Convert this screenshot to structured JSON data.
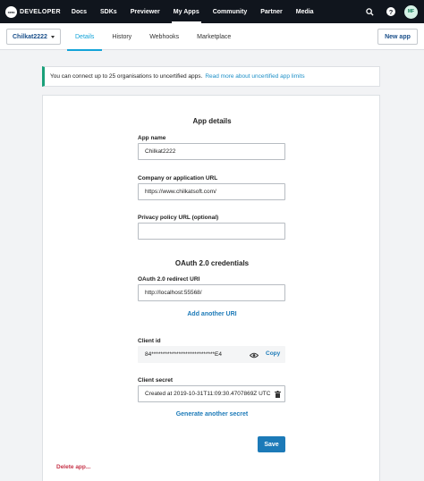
{
  "topnav": {
    "logo_mark": "xero",
    "logo_text": "DEVELOPER",
    "items": [
      {
        "label": "Docs"
      },
      {
        "label": "SDKs"
      },
      {
        "label": "Previewer"
      },
      {
        "label": "My Apps",
        "active": true
      },
      {
        "label": "Community"
      },
      {
        "label": "Partner"
      },
      {
        "label": "Media"
      }
    ],
    "icons": [
      "search-icon",
      "help-icon"
    ],
    "avatar_initials": "MF"
  },
  "subbar": {
    "app_selector": "Chilkat2222",
    "tabs": [
      {
        "label": "Details",
        "active": true
      },
      {
        "label": "History"
      },
      {
        "label": "Webhooks"
      },
      {
        "label": "Marketplace"
      }
    ],
    "new_app_label": "New app"
  },
  "notice": {
    "text": "You can connect up to 25 organisations to uncertified apps.",
    "link": "Read more about uncertified app limits"
  },
  "form": {
    "app_details_title": "App details",
    "app_name_label": "App name",
    "app_name_value": "Chilkat2222",
    "company_url_label": "Company or application URL",
    "company_url_value": "https://www.chilkatsoft.com/",
    "privacy_url_label": "Privacy policy URL (optional)",
    "privacy_url_value": "",
    "oauth_title": "OAuth 2.0 credentials",
    "redirect_uri_label": "OAuth 2.0 redirect URI",
    "redirect_uri_value": "http://localhost:55568/",
    "add_uri_label": "Add another URI",
    "client_id_label": "Client id",
    "client_id_value": "84****************************E4",
    "copy_label": "Copy",
    "client_secret_label": "Client secret",
    "client_secret_value": "Created at 2019-10-31T11:09:30.4707869Z UTC",
    "generate_secret_label": "Generate another secret",
    "save_label": "Save",
    "delete_label": "Delete app..."
  },
  "colors": {
    "nav_bg": "#10151d",
    "accent": "#13a3d9",
    "primary": "#1c7ab8",
    "success_border": "#1aa07a",
    "danger": "#c63348"
  }
}
